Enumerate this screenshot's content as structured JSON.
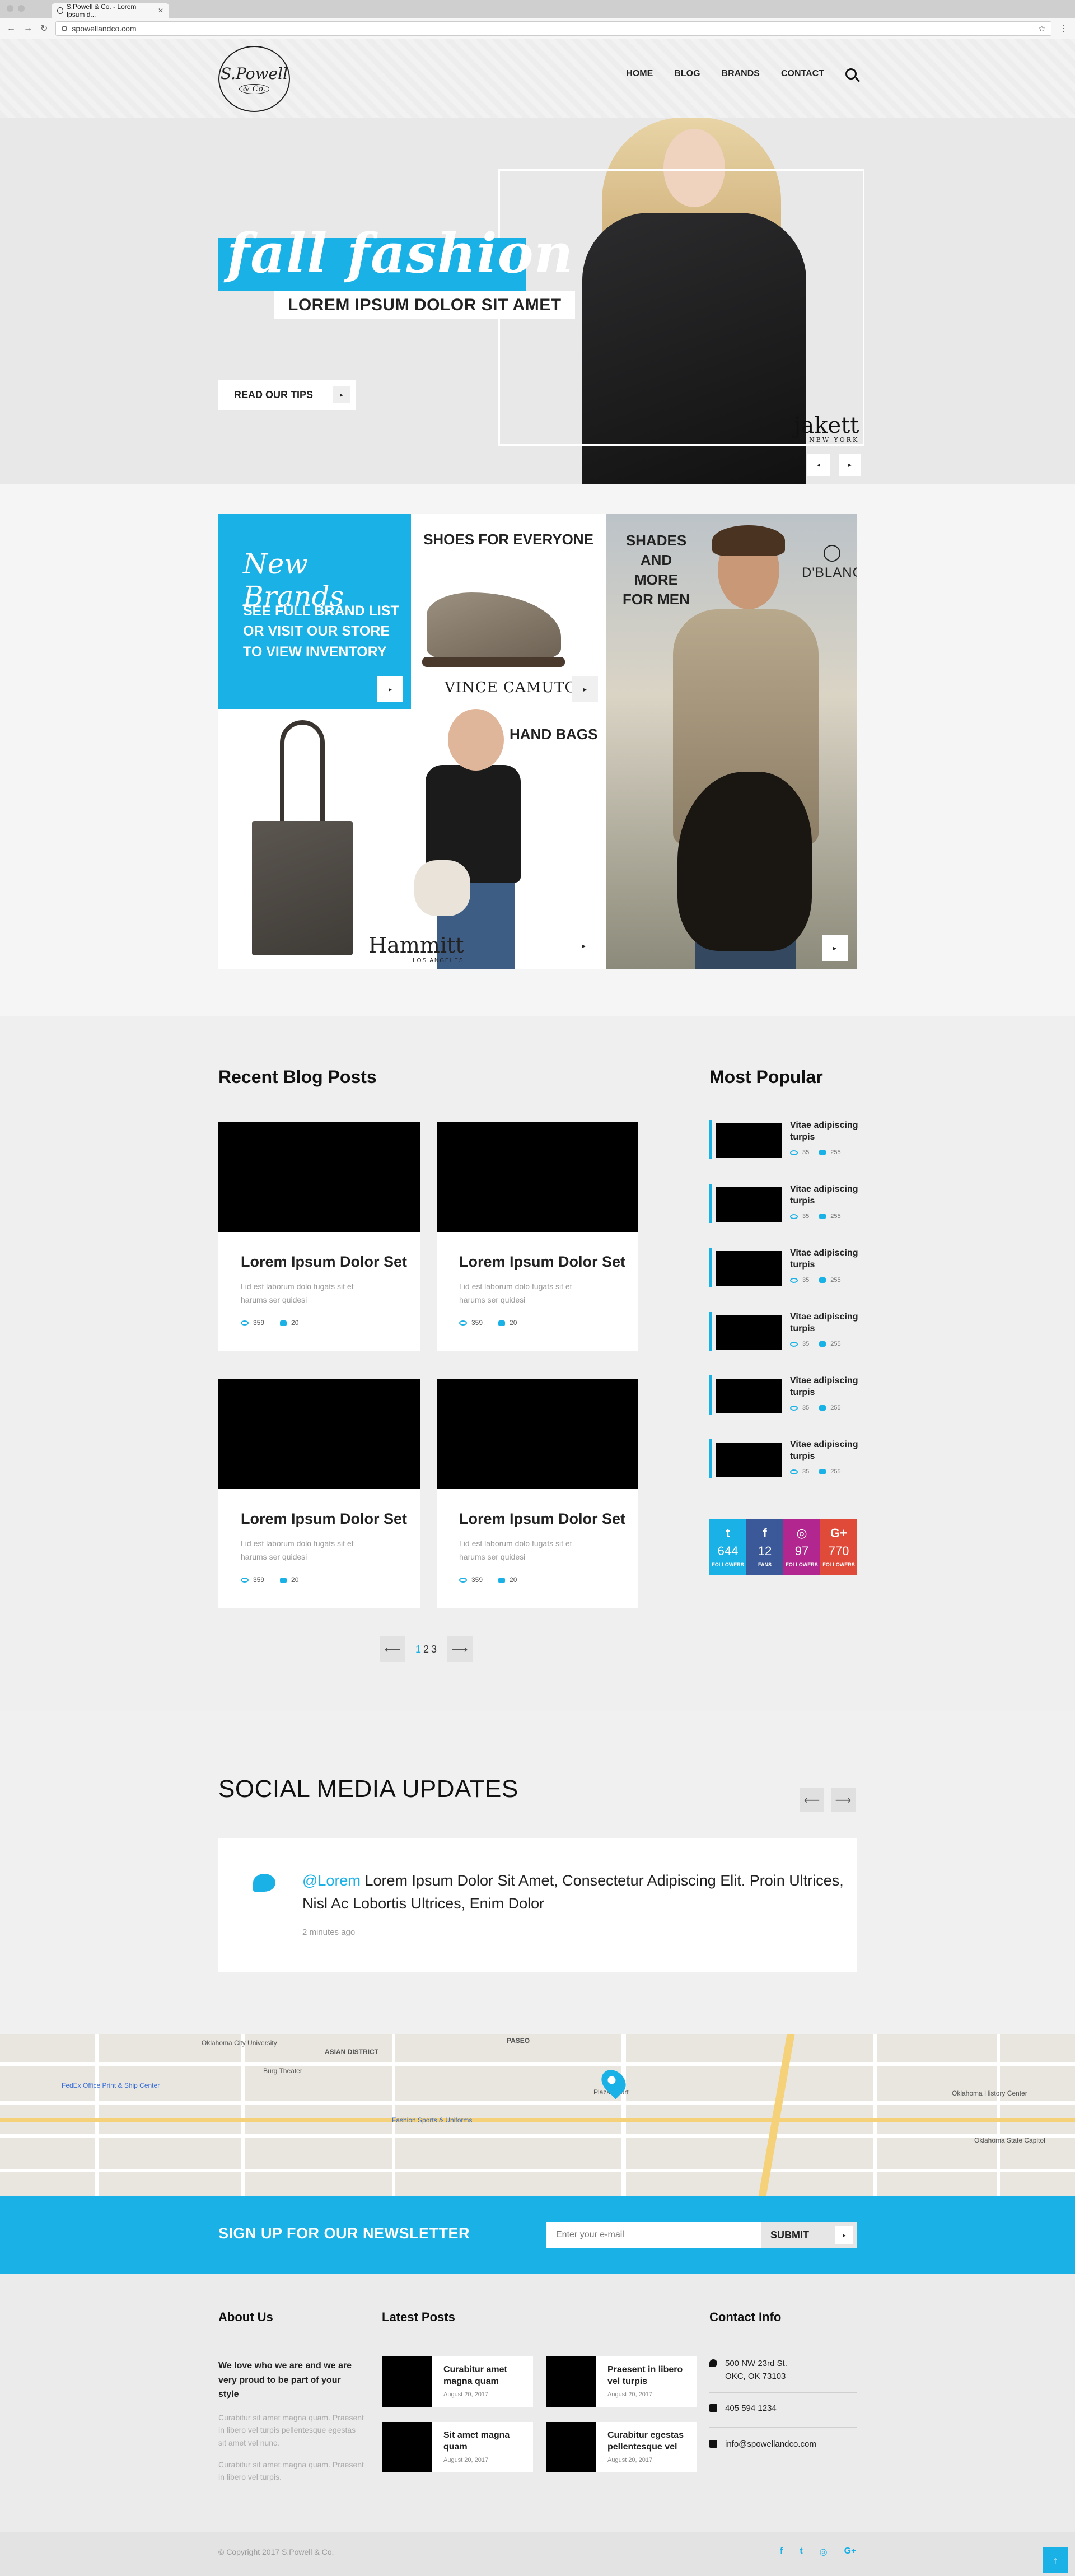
{
  "browser": {
    "tab_title": "S.Powell & Co. - Lorem Ipsum d...",
    "url": "spowellandco.com"
  },
  "header": {
    "logo_main": "S.Powell",
    "logo_sub": "& Co.",
    "nav": [
      "HOME",
      "BLOG",
      "BRANDS",
      "CONTACT"
    ]
  },
  "hero": {
    "headline": "fall fashion",
    "subhead": "LOREM IPSUM DOLOR SIT AMET",
    "cta": "READ OUR TIPS",
    "brand": "jakett",
    "brand_sub": "NEW YORK",
    "prev": "◂",
    "next": "▸"
  },
  "brands": {
    "new_title": "New Brands",
    "new_text": "SEE FULL BRAND LIST OR VISIT OUR STORE TO VIEW INVENTORY",
    "shoes_title": "SHOES FOR EVERYONE",
    "shoes_brand": "VINCE CAMUTO",
    "shades_title": "SHADES AND MORE FOR MEN",
    "shades_brand": "D'BLANC",
    "bags_title": "HAND BAGS",
    "bags_brand": "Hammitt",
    "bags_brand_sub": "LOS ANGELES",
    "arrow": "▸"
  },
  "blog": {
    "title": "Recent Blog Posts",
    "posts": [
      {
        "title": "Lorem Ipsum Dolor Set",
        "excerpt": "Lid est laborum dolo fugats sit et harums ser quidesi",
        "views": "359",
        "comments": "20"
      },
      {
        "title": "Lorem Ipsum Dolor Set",
        "excerpt": "Lid est laborum dolo fugats sit et harums ser quidesi",
        "views": "359",
        "comments": "20"
      },
      {
        "title": "Lorem Ipsum Dolor Set",
        "excerpt": "Lid est laborum dolo fugats sit et harums ser quidesi",
        "views": "359",
        "comments": "20"
      },
      {
        "title": "Lorem Ipsum Dolor Set",
        "excerpt": "Lid est laborum dolo fugats sit et harums ser quidesi",
        "views": "359",
        "comments": "20"
      }
    ],
    "pager": {
      "prev": "⟵",
      "pages": [
        "1",
        "2",
        "3"
      ],
      "next": "⟶"
    }
  },
  "popular": {
    "title": "Most Popular",
    "items": [
      {
        "title": "Vitae adipiscing turpis",
        "views": "35",
        "comments": "255"
      },
      {
        "title": "Vitae adipiscing turpis",
        "views": "35",
        "comments": "255"
      },
      {
        "title": "Vitae adipiscing turpis",
        "views": "35",
        "comments": "255"
      },
      {
        "title": "Vitae adipiscing turpis",
        "views": "35",
        "comments": "255"
      },
      {
        "title": "Vitae adipiscing turpis",
        "views": "35",
        "comments": "255"
      },
      {
        "title": "Vitae adipiscing turpis",
        "views": "35",
        "comments": "255"
      }
    ]
  },
  "social_counts": [
    {
      "icon": "t",
      "count": "644",
      "label": "FOLLOWERS",
      "color": "#1ab1e6"
    },
    {
      "icon": "f",
      "count": "12",
      "label": "FANS",
      "color": "#3b5998"
    },
    {
      "icon": "◎",
      "count": "97",
      "label": "FOLLOWERS",
      "color": "#b2278f"
    },
    {
      "icon": "G+",
      "count": "770",
      "label": "FOLLOWERS",
      "color": "#e04a39"
    }
  ],
  "social_updates": {
    "title": "SOCIAL MEDIA UPDATES",
    "prev": "⟵",
    "next": "⟶",
    "tweet_handle": "@Lorem",
    "tweet_text": " Lorem Ipsum Dolor Sit Amet, Consectetur Adipiscing Elit. Proin Ultrices, Nisl Ac Lobortis Ultrices, Enim Dolor",
    "tweet_time": "2 minutes ago"
  },
  "map": {
    "labels": [
      "Oklahoma City University",
      "ASIAN DISTRICT",
      "PASEO",
      "Plaza Court",
      "Fashion Sports & Uniforms",
      "FedEx Office Print & Ship Center",
      "Oklahoma History Center",
      "Oklahoma State Capitol",
      "Burg Theater"
    ]
  },
  "newsletter": {
    "title": "SIGN UP FOR OUR NEWSLETTER",
    "placeholder": "Enter your e-mail",
    "submit": "SUBMIT",
    "arrow": "▸"
  },
  "footer": {
    "about_title": "About Us",
    "about_lead": "We love who we are and we are very proud to be part of your style",
    "about_p1": "Curabitur sit amet magna quam. Praesent in libero vel turpis pellentesque egestas sit amet vel nunc.",
    "about_p2": "Curabitur sit amet magna quam. Praesent in libero vel turpis.",
    "latest_title": "Latest Posts",
    "latest": [
      {
        "title": "Curabitur amet magna quam",
        "date": "August 20, 2017"
      },
      {
        "title": "Praesent in libero vel turpis",
        "date": "August 20, 2017"
      },
      {
        "title": "Sit amet magna quam",
        "date": "August 20, 2017"
      },
      {
        "title": "Curabitur egestas pellentesque vel",
        "date": "August 20, 2017"
      }
    ],
    "contact_title": "Contact Info",
    "address": "500 NW 23rd St. OKC, OK 73103",
    "phone": "405 594 1234",
    "email": "info@spowellandco.com",
    "copyright": "© Copyright 2017 S.Powell & Co.",
    "social_icons": [
      "f",
      "t",
      "◎",
      "G+"
    ],
    "totop": "↑"
  },
  "colors": {
    "accent": "#1ab1e6"
  }
}
